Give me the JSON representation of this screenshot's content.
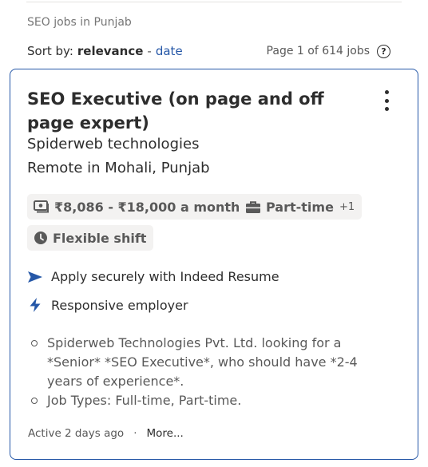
{
  "breadcrumb": "SEO jobs in Punjab",
  "sort": {
    "label": "Sort by:",
    "selected": "relevance",
    "separator": "-",
    "alternate": "date"
  },
  "page_info": "Page 1 of 614 jobs",
  "job": {
    "title": "SEO Executive (on page and off page expert)",
    "company": "Spiderweb technologies",
    "location": "Remote in Mohali, Punjab",
    "salary": "₹8,086 - ₹18,000 a month",
    "job_type": "Part-time",
    "job_type_extra": "+1",
    "shift": "Flexible shift",
    "features": [
      "Apply securely with Indeed Resume",
      "Responsive employer"
    ],
    "snippet": [
      "Spiderweb Technologies Pvt. Ltd. looking for a *Senior* *SEO Executive*, who should have *2-4 years of experience*.",
      "Job Types: Full-time, Part-time."
    ],
    "posted": "Active 2 days ago",
    "footer_separator": "·",
    "more_label": "More..."
  },
  "colors": {
    "link": "#2557a7",
    "text": "#2d2d2d",
    "muted": "#595959",
    "chip_bg": "#f3f2f1",
    "card_border": "#2557a7"
  },
  "icons": [
    "money-icon",
    "briefcase-icon",
    "clock-icon",
    "send-icon",
    "bolt-icon",
    "help-icon",
    "more-vertical-icon"
  ]
}
